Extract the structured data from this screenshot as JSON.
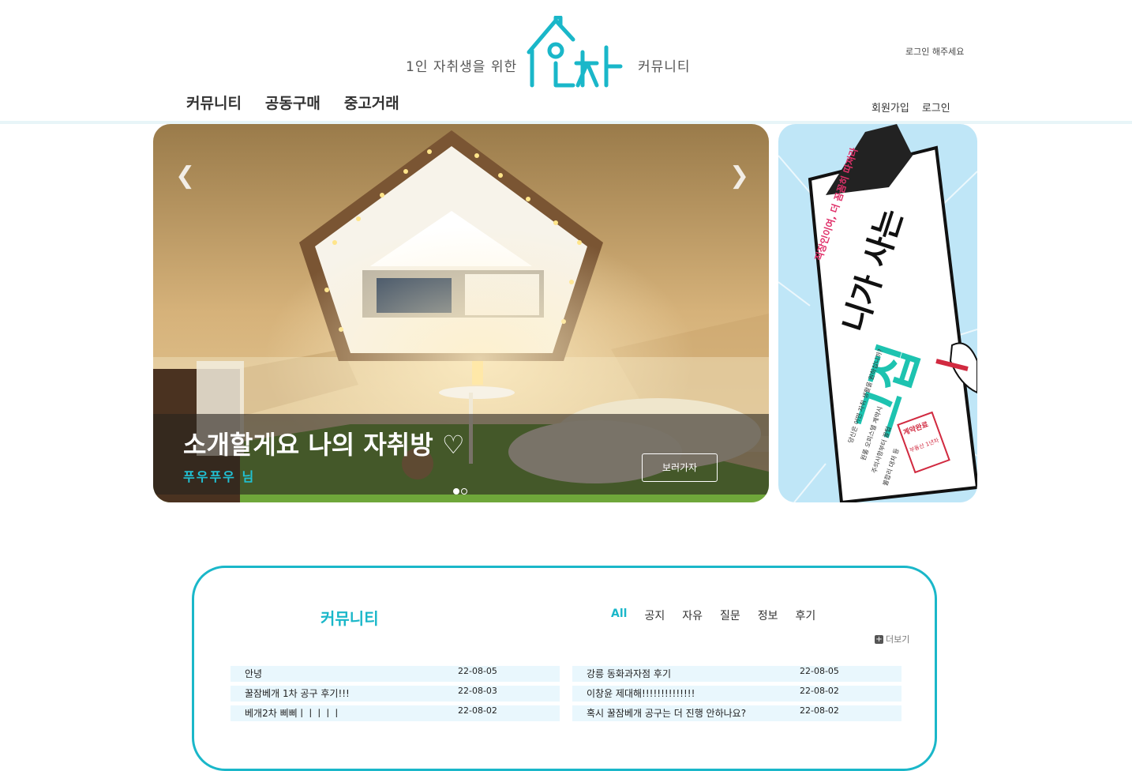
{
  "header": {
    "tagline_left": "1인 자취생을 위한",
    "tagline_right": "커뮤니티",
    "login_hint": "로그인 해주세요",
    "brand_color": "#1ab7c9"
  },
  "gnb": [
    "커뮤니티",
    "공동구매",
    "중고거래"
  ],
  "user_menu": {
    "signup": "회원가입",
    "login": "로그인"
  },
  "hero": {
    "title": "소개할게요 나의 자취방 ♡",
    "author": "푸우푸우 님",
    "button": "보러가자",
    "prev_icon": "chevron-left-icon",
    "next_icon": "chevron-right-icon",
    "slide_count": 2,
    "active_slide": 1
  },
  "ad": {
    "top_line": "직장인이여, 더 꼼꼼히 따져라",
    "headline_1": "니가 사는",
    "headline_2": "그집",
    "question": "당신은 어떤 자취 생활을 원하십니까?",
    "list": [
      "원룸 오피스텔 계약시",
      "주의사항부터 꿀팁",
      "불합리 대처 등"
    ],
    "stamp": "계약완료",
    "stamp_sub": "부동산 1년차"
  },
  "community": {
    "title": "커뮤니티",
    "tabs": [
      "All",
      "공지",
      "자유",
      "질문",
      "정보",
      "후기"
    ],
    "active_tab": "All",
    "more": "더보기",
    "left_posts": [
      {
        "title": "안녕",
        "date": "22-08-05"
      },
      {
        "title": "꿀잠베개 1차 공구 후기!!!",
        "date": "22-08-03"
      },
      {
        "title": "베개2차 삐삐ㅣㅣㅣㅣㅣ",
        "date": "22-08-02"
      }
    ],
    "right_posts": [
      {
        "title": "강릉 동화과자점 후기",
        "date": "22-08-05"
      },
      {
        "title": "이창윤 제대해!!!!!!!!!!!!!!",
        "date": "22-08-02"
      },
      {
        "title": "혹시 꿀잠베개 공구는 더 진행 안하나요?",
        "date": "22-08-02"
      }
    ]
  }
}
